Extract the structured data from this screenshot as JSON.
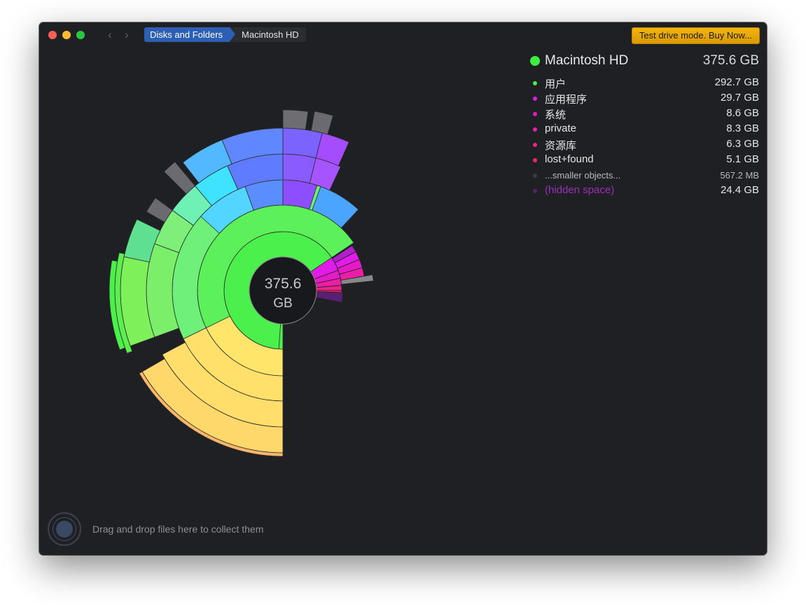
{
  "window": {
    "breadcrumb": [
      "Disks and Folders",
      "Macintosh HD"
    ],
    "buy_button": "Test drive mode. Buy Now..."
  },
  "legend": {
    "title": "Macintosh HD",
    "total": "375.6 GB",
    "items": [
      {
        "name": "用户",
        "size": "292.7 GB",
        "color": "#4cf04c"
      },
      {
        "name": "应用程序",
        "size": "29.7 GB",
        "color": "#e21ce8"
      },
      {
        "name": "系统",
        "size": "8.6 GB",
        "color": "#e51cc5"
      },
      {
        "name": "private",
        "size": "8.3 GB",
        "color": "#ea1fa6"
      },
      {
        "name": "资源库",
        "size": "6.3 GB",
        "color": "#ec2488"
      },
      {
        "name": "lost+found",
        "size": "5.1 GB",
        "color": "#ee2868"
      },
      {
        "name": "...smaller objects...",
        "size": "567.2  MB",
        "color": "#3a3b40"
      },
      {
        "name": "(hidden space)",
        "size": "24.4 GB",
        "color": "#5a1f70"
      }
    ]
  },
  "center": {
    "value": "375.6",
    "unit": "GB"
  },
  "drop_zone": {
    "text": "Drag and drop files here to collect them"
  }
}
